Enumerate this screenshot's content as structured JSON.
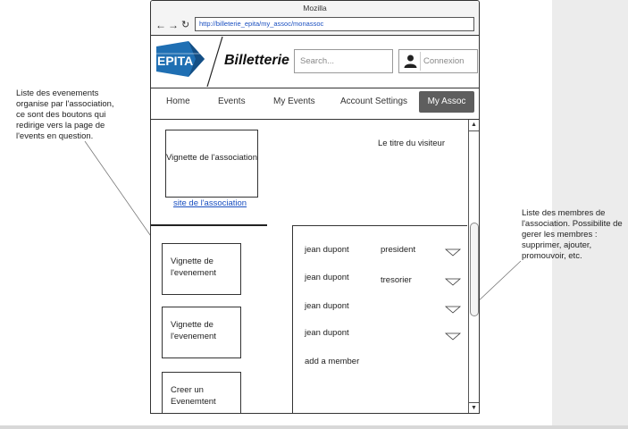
{
  "browser": {
    "title": "Mozilla",
    "url": "http://billeterie_epita/my_assoc/monassoc",
    "back_icon": "arrow-left-icon",
    "forward_icon": "arrow-right-icon",
    "reload_icon": "reload-icon"
  },
  "header": {
    "logo_text": "EPITA",
    "brand": "Billetterie",
    "search_placeholder": "Search...",
    "login_label": "Connexion",
    "login_icon": "user-icon"
  },
  "menu": {
    "items": [
      {
        "label": "Home"
      },
      {
        "label": "Events"
      },
      {
        "label": "My Events"
      },
      {
        "label": "Account Settings"
      },
      {
        "label": "My Assoc"
      }
    ],
    "active": "My Assoc"
  },
  "association": {
    "thumbnail_label": "Vignette de l'association",
    "link_label": "site de l'association",
    "visitor_title": "Le titre du visiteur"
  },
  "events": [
    {
      "label": "Vignette de l'evenement"
    },
    {
      "label": "Vignette de l'evenement"
    },
    {
      "label": "Creer un Evenemtent"
    }
  ],
  "members": {
    "list": [
      {
        "name": "jean dupont",
        "role": "president"
      },
      {
        "name": "jean dupont",
        "role": "tresorier"
      },
      {
        "name": "jean dupont",
        "role": ""
      },
      {
        "name": "jean dupont",
        "role": ""
      }
    ],
    "add_label": "add a member"
  },
  "annotations": {
    "left": "Liste des evenements organise par l'association, ce sont des boutons qui redirige vers la page de l'events en question.",
    "right": "Liste des membres de l'association. Possibilite de gerer les membres : supprimer, ajouter, promouvoir, etc."
  },
  "colors": {
    "logo_blue": "#1f6fb3",
    "active_tab": "#5e5e5e",
    "link": "#1a4fc0"
  }
}
